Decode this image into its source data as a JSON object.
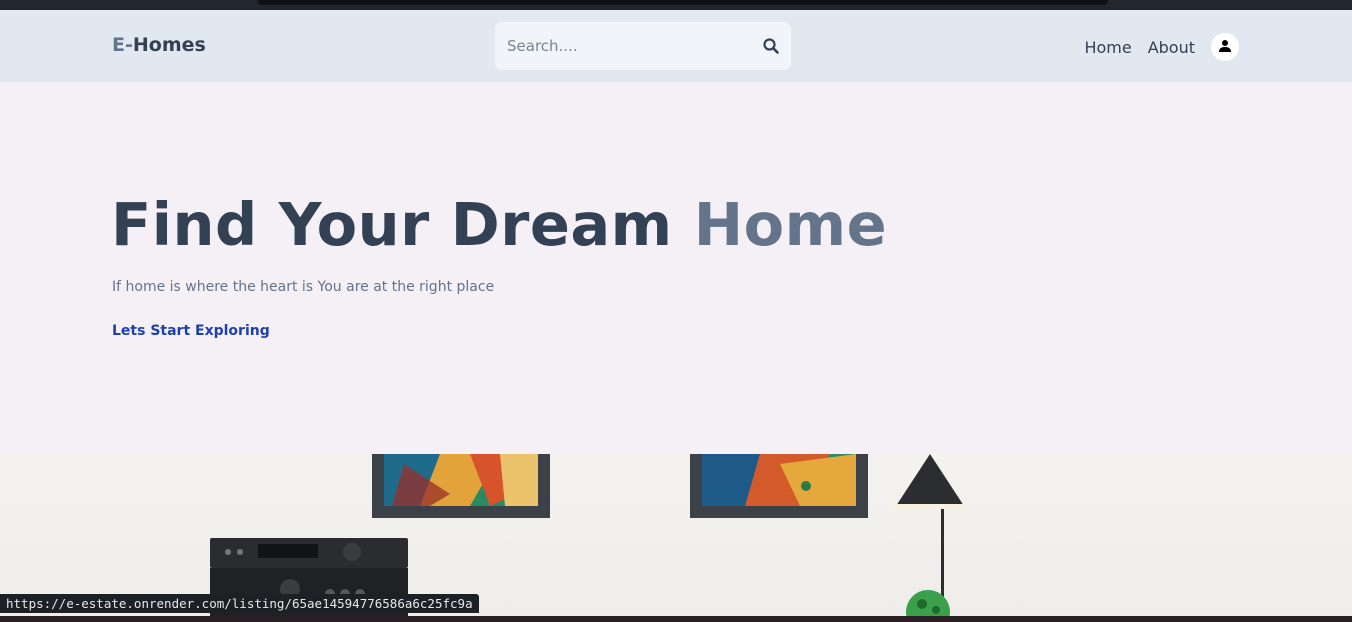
{
  "header": {
    "logo_first": "E-",
    "logo_rest": "Homes",
    "search_placeholder": "Search....",
    "nav": {
      "home": "Home",
      "about": "About"
    }
  },
  "hero": {
    "title_main": "Find Your Dream ",
    "title_accent": "Home",
    "subtitle": "If home is where the heart is You are at the right place",
    "cta": "Lets Start Exploring"
  },
  "status_bar": {
    "url": "https://e-estate.onrender.com/listing/65ae14594776586a6c25fc9a"
  },
  "icons": {
    "search": "search-icon",
    "user": "user-icon"
  },
  "colors": {
    "header_bg": "#e2e8f0",
    "hero_bg": "#f5f0f5",
    "title": "#334155",
    "accent": "#64748b",
    "cta": "#1e40af"
  }
}
